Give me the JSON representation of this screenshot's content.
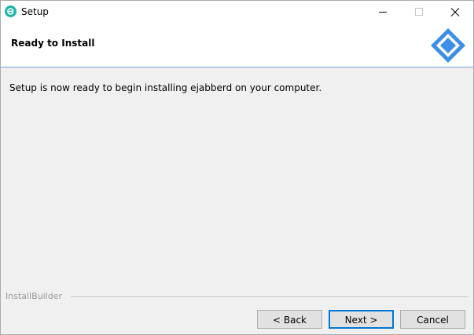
{
  "window": {
    "title": "Setup",
    "app_icon": "ejabberd-e-icon"
  },
  "header": {
    "title": "Ready to Install",
    "logo_icon": "installbuilder-diamond-logo"
  },
  "body": {
    "message": "Setup is now ready to begin installing ejabberd on your computer."
  },
  "footer": {
    "brand_label": "InstallBuilder",
    "back_label": "< Back",
    "next_label": "Next >",
    "cancel_label": "Cancel"
  },
  "colors": {
    "accent": "#0078d7",
    "logo_blue": "#3d8ee8",
    "header_separator": "#7aa3d6",
    "app_icon_teal": "#1fb4a8"
  }
}
